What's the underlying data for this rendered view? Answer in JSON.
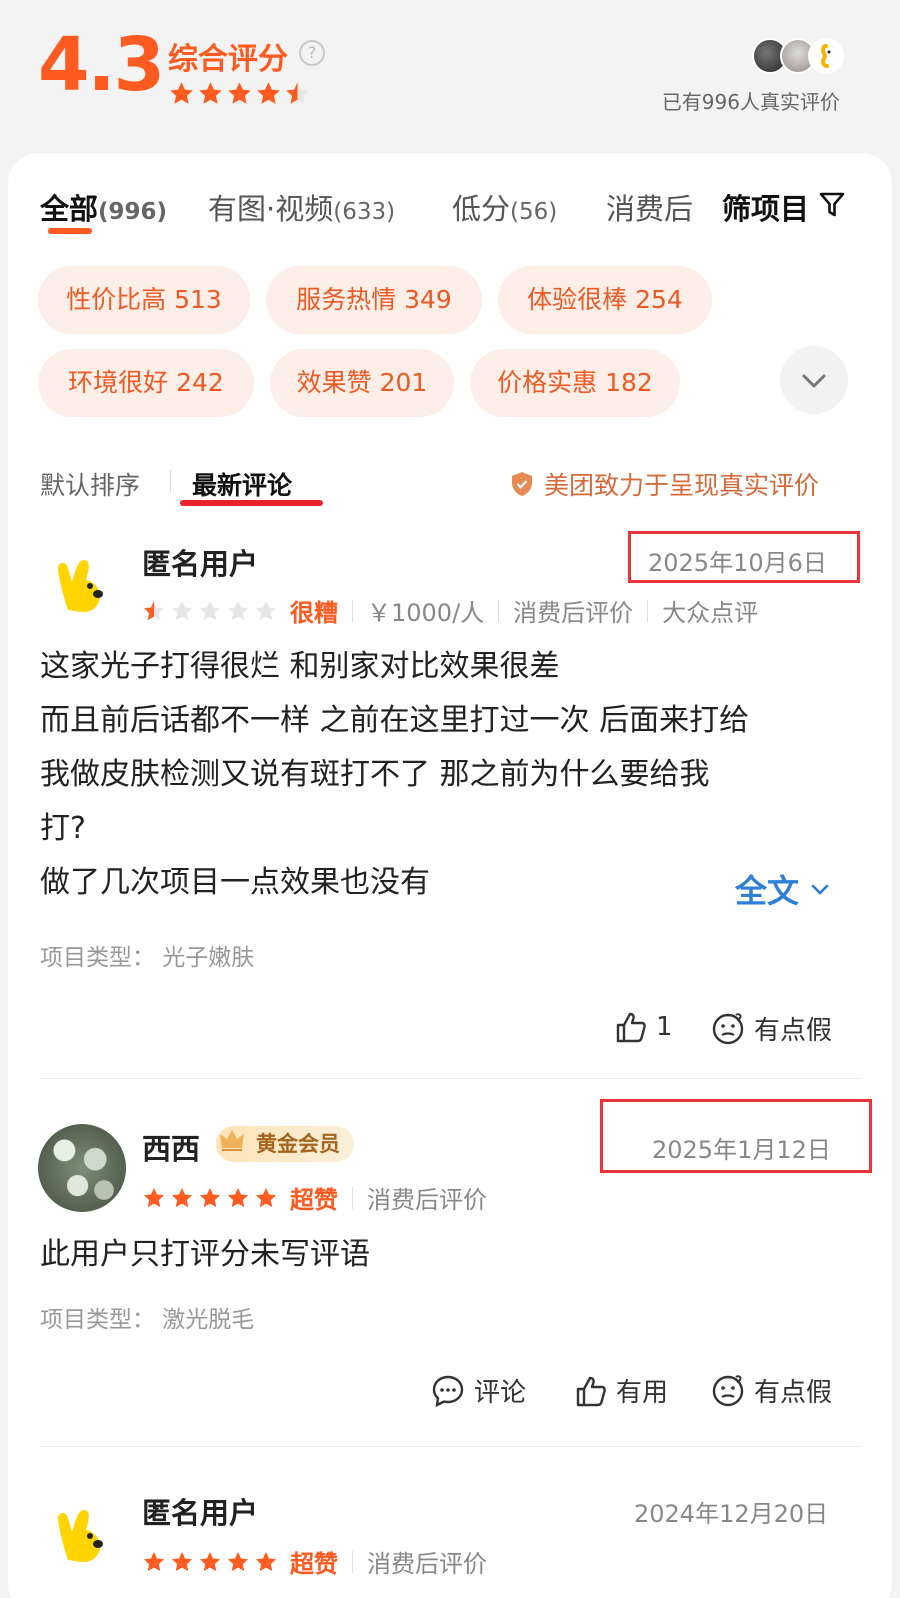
{
  "header": {
    "score": "4.3",
    "score_label": "综合评分",
    "help": "?",
    "rating_stars": 4.5,
    "real_review_count": "已有996人真实评价"
  },
  "tabs": [
    {
      "label": "全部",
      "count": "(996)"
    },
    {
      "label": "有图·视频",
      "count": "(633)"
    },
    {
      "label": "低分",
      "count": "(56)"
    },
    {
      "label": "消费后",
      "count": ""
    }
  ],
  "filter_label": "筛项目",
  "tags": [
    "性价比高 513",
    "服务热情 349",
    "体验很棒 254",
    "环境很好 242",
    "效果赞 201",
    "价格实惠 182"
  ],
  "sort": {
    "default": "默认排序",
    "latest": "最新评论",
    "trust_text": "美团致力于呈现真实评价"
  },
  "reviews": [
    {
      "user": "匿名用户",
      "date": "2025年10月6日",
      "stars": 1,
      "level": "很糟",
      "price": "￥1000/人",
      "tag": "消费后评价",
      "source": "大众点评",
      "content": [
        "这家光子打得很烂 和别家对比效果很差",
        "而且前后话都不一样 之前在这里打过一次 后面来打给",
        "我做皮肤检测又说有斑打不了 那之前为什么要给我",
        "打?",
        "做了几次项目一点效果也没有"
      ],
      "more": "全文",
      "project_type": "项目类型：  光子嫩肤",
      "like_count": "1",
      "fake_label": "有点假"
    },
    {
      "user": "西西",
      "badge": "黄金会员",
      "date": "2025年1月12日",
      "stars": 5,
      "level": "超赞",
      "tag": "消费后评价",
      "content": [
        "此用户只打评分未写评语"
      ],
      "project_type": "项目类型：  激光脱毛",
      "comment_label": "评论",
      "useful_label": "有用",
      "fake_label": "有点假"
    },
    {
      "user": "匿名用户",
      "date": "2024年12月20日",
      "stars": 5,
      "level": "超赞",
      "tag": "消费后评价"
    }
  ],
  "colors": {
    "accent": "#ff5a1f",
    "chip_bg": "#fdeee8",
    "link": "#2f7fd8",
    "highlight_box": "#e8323c"
  }
}
